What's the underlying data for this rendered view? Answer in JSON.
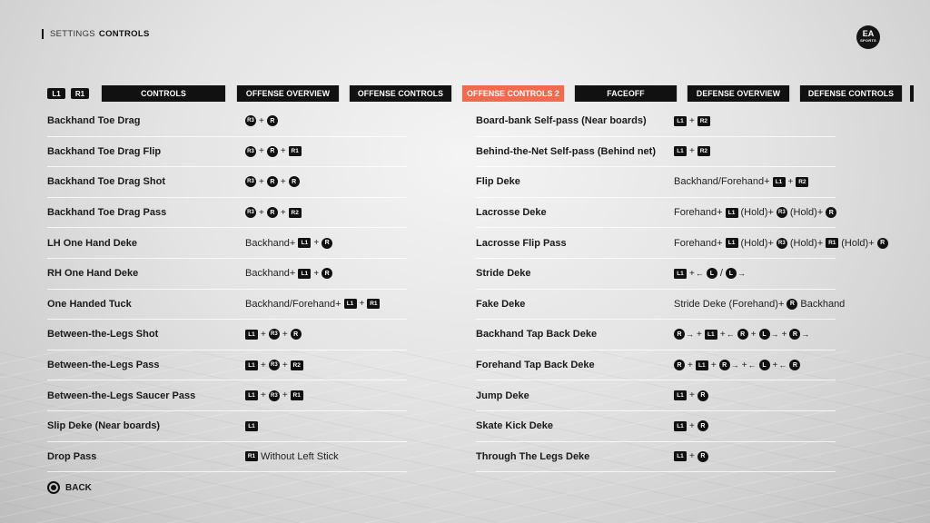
{
  "breadcrumb": {
    "parent": "SETTINGS",
    "current": "CONTROLS"
  },
  "logo": {
    "text": "EA",
    "sub": "SPORTS"
  },
  "bumpers": {
    "left": "L1",
    "right": "R1"
  },
  "tabs": [
    {
      "label": "CONTROLS"
    },
    {
      "label": "OFFENSE OVERVIEW"
    },
    {
      "label": "OFFENSE CONTROLS"
    },
    {
      "label": "OFFENSE CONTROLS 2"
    },
    {
      "label": "FACEOFF"
    },
    {
      "label": "DEFENSE OVERVIEW"
    },
    {
      "label": "DEFENSE CONTROLS"
    }
  ],
  "active_tab_color": "#f06a4e",
  "left_list": [
    {
      "name": "Backhand Toe Drag",
      "combo": [
        {
          "k": "c",
          "t": "R3"
        },
        {
          "k": "+"
        },
        {
          "k": "s",
          "t": "R"
        }
      ]
    },
    {
      "name": "Backhand Toe Drag Flip",
      "combo": [
        {
          "k": "c",
          "t": "R3"
        },
        {
          "k": "+"
        },
        {
          "k": "s",
          "t": "R"
        },
        {
          "k": "+"
        },
        {
          "k": "b",
          "t": "R1"
        }
      ]
    },
    {
      "name": "Backhand Toe Drag Shot",
      "combo": [
        {
          "k": "c",
          "t": "R3"
        },
        {
          "k": "+"
        },
        {
          "k": "s",
          "t": "R"
        },
        {
          "k": "+"
        },
        {
          "k": "s",
          "t": "R"
        }
      ]
    },
    {
      "name": "Backhand Toe Drag Pass",
      "combo": [
        {
          "k": "c",
          "t": "R3"
        },
        {
          "k": "+"
        },
        {
          "k": "s",
          "t": "R"
        },
        {
          "k": "+"
        },
        {
          "k": "b",
          "t": "R2"
        }
      ]
    },
    {
      "name": "LH One Hand Deke",
      "combo": [
        {
          "k": "t",
          "t": "Backhand+"
        },
        {
          "k": "b",
          "t": "L1"
        },
        {
          "k": "+"
        },
        {
          "k": "s",
          "t": "R"
        }
      ]
    },
    {
      "name": "RH One Hand Deke",
      "combo": [
        {
          "k": "t",
          "t": "Backhand+"
        },
        {
          "k": "b",
          "t": "L1"
        },
        {
          "k": "+"
        },
        {
          "k": "s",
          "t": "R"
        }
      ]
    },
    {
      "name": "One Handed Tuck",
      "combo": [
        {
          "k": "t",
          "t": "Backhand/Forehand+"
        },
        {
          "k": "b",
          "t": "L1"
        },
        {
          "k": "+"
        },
        {
          "k": "b",
          "t": "R1"
        }
      ]
    },
    {
      "name": "Between-the-Legs Shot",
      "combo": [
        {
          "k": "b",
          "t": "L1"
        },
        {
          "k": "+"
        },
        {
          "k": "c",
          "t": "R3"
        },
        {
          "k": "+"
        },
        {
          "k": "s",
          "t": "R"
        }
      ]
    },
    {
      "name": "Between-the-Legs Pass",
      "combo": [
        {
          "k": "b",
          "t": "L1"
        },
        {
          "k": "+"
        },
        {
          "k": "c",
          "t": "R3"
        },
        {
          "k": "+"
        },
        {
          "k": "b",
          "t": "R2"
        }
      ]
    },
    {
      "name": "Between-the-Legs Saucer Pass",
      "combo": [
        {
          "k": "b",
          "t": "L1"
        },
        {
          "k": "+"
        },
        {
          "k": "c",
          "t": "R3"
        },
        {
          "k": "+"
        },
        {
          "k": "b",
          "t": "R1"
        }
      ]
    },
    {
      "name": "Slip Deke (Near boards)",
      "combo": [
        {
          "k": "b",
          "t": "L1"
        }
      ]
    },
    {
      "name": "Drop Pass",
      "combo": [
        {
          "k": "b",
          "t": "R1"
        },
        {
          "k": "t",
          "t": "Without Left Stick"
        }
      ]
    }
  ],
  "right_list": [
    {
      "name": "Board-bank Self-pass (Near boards)",
      "combo": [
        {
          "k": "b",
          "t": "L1"
        },
        {
          "k": "+"
        },
        {
          "k": "b",
          "t": "R2"
        }
      ]
    },
    {
      "name": "Behind-the-Net Self-pass (Behind net)",
      "combo": [
        {
          "k": "b",
          "t": "L1"
        },
        {
          "k": "+"
        },
        {
          "k": "b",
          "t": "R2"
        }
      ]
    },
    {
      "name": "Flip Deke",
      "combo": [
        {
          "k": "t",
          "t": "Backhand/Forehand+"
        },
        {
          "k": "b",
          "t": "L1"
        },
        {
          "k": "+"
        },
        {
          "k": "b",
          "t": "R2"
        }
      ]
    },
    {
      "name": "Lacrosse Deke",
      "combo": [
        {
          "k": "t",
          "t": "Forehand+"
        },
        {
          "k": "b",
          "t": "L1"
        },
        {
          "k": "t",
          "t": "(Hold)+"
        },
        {
          "k": "c",
          "t": "R3"
        },
        {
          "k": "t",
          "t": "(Hold)+"
        },
        {
          "k": "s",
          "t": "R"
        }
      ]
    },
    {
      "name": "Lacrosse Flip Pass",
      "combo": [
        {
          "k": "t",
          "t": "Forehand+"
        },
        {
          "k": "b",
          "t": "L1"
        },
        {
          "k": "t",
          "t": "(Hold)+"
        },
        {
          "k": "c",
          "t": "R3"
        },
        {
          "k": "t",
          "t": "(Hold)+"
        },
        {
          "k": "b",
          "t": "R1"
        },
        {
          "k": "t",
          "t": "(Hold)+"
        },
        {
          "k": "s",
          "t": "R"
        }
      ]
    },
    {
      "name": "Stride Deke",
      "combo": [
        {
          "k": "b",
          "t": "L1"
        },
        {
          "k": "+"
        },
        {
          "k": "a",
          "t": "←"
        },
        {
          "k": "s",
          "t": "L"
        },
        {
          "k": "t",
          "t": "/"
        },
        {
          "k": "s",
          "t": "L"
        },
        {
          "k": "a",
          "t": "→"
        }
      ]
    },
    {
      "name": "Fake Deke",
      "combo": [
        {
          "k": "t",
          "t": "Stride Deke (Forehand)+"
        },
        {
          "k": "s",
          "t": "R"
        },
        {
          "k": "t",
          "t": "Backhand"
        }
      ]
    },
    {
      "name": "Backhand Tap Back Deke",
      "combo": [
        {
          "k": "s",
          "t": "R"
        },
        {
          "k": "a",
          "t": "→"
        },
        {
          "k": "+"
        },
        {
          "k": "b",
          "t": "L1"
        },
        {
          "k": "+"
        },
        {
          "k": "a",
          "t": "←"
        },
        {
          "k": "s",
          "t": "R"
        },
        {
          "k": "+"
        },
        {
          "k": "s",
          "t": "L"
        },
        {
          "k": "a",
          "t": "→"
        },
        {
          "k": "+"
        },
        {
          "k": "s",
          "t": "R"
        },
        {
          "k": "a",
          "t": "→"
        }
      ]
    },
    {
      "name": "Forehand Tap Back Deke",
      "combo": [
        {
          "k": "s",
          "t": "R"
        },
        {
          "k": "+"
        },
        {
          "k": "b",
          "t": "L1"
        },
        {
          "k": "+"
        },
        {
          "k": "s",
          "t": "R"
        },
        {
          "k": "a",
          "t": "→"
        },
        {
          "k": "+"
        },
        {
          "k": "a",
          "t": "←"
        },
        {
          "k": "s",
          "t": "L"
        },
        {
          "k": "+"
        },
        {
          "k": "a",
          "t": "←"
        },
        {
          "k": "s",
          "t": "R"
        }
      ]
    },
    {
      "name": "Jump Deke",
      "combo": [
        {
          "k": "b",
          "t": "L1"
        },
        {
          "k": "+"
        },
        {
          "k": "s",
          "t": "R"
        }
      ]
    },
    {
      "name": "Skate Kick Deke",
      "combo": [
        {
          "k": "b",
          "t": "L1"
        },
        {
          "k": "+"
        },
        {
          "k": "s",
          "t": "R"
        }
      ]
    },
    {
      "name": "Through The Legs Deke",
      "combo": [
        {
          "k": "b",
          "t": "L1"
        },
        {
          "k": "+"
        },
        {
          "k": "s",
          "t": "R"
        }
      ]
    }
  ],
  "back": {
    "label": "BACK"
  }
}
